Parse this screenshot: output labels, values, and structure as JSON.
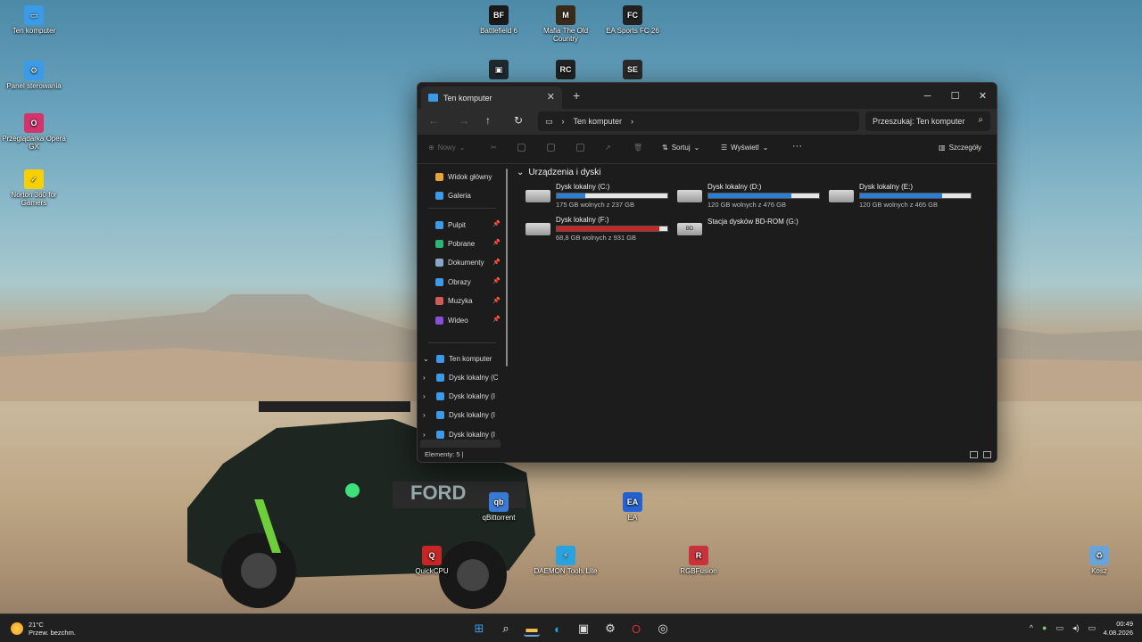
{
  "desktop": {
    "icons": [
      {
        "label": "Ten komputer",
        "glyph": "▭",
        "color": "#3b9be8"
      },
      {
        "label": "Panel sterowania",
        "glyph": "⚙",
        "color": "#3b9be8"
      },
      {
        "label": "Przeglądarka Opera GX",
        "glyph": "O",
        "color": "#d4336b"
      },
      {
        "label": "Norton 360 for Gamers",
        "glyph": "✓",
        "color": "#f6d000"
      },
      {
        "label": "Battlefield 6",
        "glyph": "BF",
        "color": "#1a1a1a"
      },
      {
        "label": "Mafia The Old Country",
        "glyph": "M",
        "color": "#3a2a1a"
      },
      {
        "label": "EA Sports FC 26",
        "glyph": "FC",
        "color": "#222"
      },
      {
        "label": "",
        "glyph": "▣",
        "color": "#1e2a30"
      },
      {
        "label": "",
        "glyph": "RC",
        "color": "#222"
      },
      {
        "label": "",
        "glyph": "SE",
        "color": "#2a2a2a"
      },
      {
        "label": "qBittorrent",
        "glyph": "qb",
        "color": "#3a7bd5"
      },
      {
        "label": "EA",
        "glyph": "EA",
        "color": "#2563d4"
      },
      {
        "label": "QuickCPU",
        "glyph": "Q",
        "color": "#c82525"
      },
      {
        "label": "DAEMON Tools Lite",
        "glyph": "⚡",
        "color": "#2aa2e0"
      },
      {
        "label": "RGBFusion",
        "glyph": "R",
        "color": "#c8323c"
      },
      {
        "label": "Kosz",
        "glyph": "♻",
        "color": "#6aa3d8"
      }
    ]
  },
  "explorer": {
    "tab_title": "Ten komputer",
    "new_tab": "+",
    "address": {
      "crumb": "Ten komputer"
    },
    "search_placeholder": "Przeszukaj: Ten komputer",
    "toolbar": {
      "new_label": "Nowy",
      "sort_label": "Sortuj",
      "view_label": "Wyświetl",
      "more_label": "···",
      "details_label": "Szczegóły"
    },
    "sidebar": {
      "top": [
        {
          "label": "Widok główny",
          "color": "#e8a33b"
        },
        {
          "label": "Galeria",
          "color": "#3b9be8"
        }
      ],
      "pinned": [
        {
          "label": "Pulpit",
          "color": "#3b9be8"
        },
        {
          "label": "Pobrane",
          "color": "#2bb673"
        },
        {
          "label": "Dokumenty",
          "color": "#8aa6c8"
        },
        {
          "label": "Obrazy",
          "color": "#3b9be8"
        },
        {
          "label": "Muzyka",
          "color": "#d45a5a"
        },
        {
          "label": "Wideo",
          "color": "#8a4fd8"
        }
      ],
      "this_pc": "Ten komputer",
      "drives": [
        "Dysk lokalny (C",
        "Dysk lokalny (I",
        "Dysk lokalny (I",
        "Dysk lokalny (I"
      ]
    },
    "group_header": "Urządzenia i dyski",
    "drives": [
      {
        "name": "Dysk lokalny (C:)",
        "free": "175 GB wolnych z 237 GB",
        "used_fraction": 0.26,
        "status": "normal"
      },
      {
        "name": "Dysk lokalny (D:)",
        "free": "120 GB wolnych z 476 GB",
        "used_fraction": 0.75,
        "status": "normal"
      },
      {
        "name": "Dysk lokalny (E:)",
        "free": "120 GB wolnych z 465 GB",
        "used_fraction": 0.74,
        "status": "normal"
      },
      {
        "name": "Dysk lokalny (F:)",
        "free": "68,8 GB wolnych z 931 GB",
        "used_fraction": 0.93,
        "status": "full"
      }
    ],
    "optical": {
      "name": "Stacja dysków BD-ROM (G:)",
      "tag": "BD"
    },
    "status_bar": "Elementy: 5  |"
  },
  "taskbar": {
    "weather_temp": "21°C",
    "weather_desc": "Przew. bezchm.",
    "time": "00:49",
    "date": "4.08.2026",
    "tray_chevron": "^"
  }
}
